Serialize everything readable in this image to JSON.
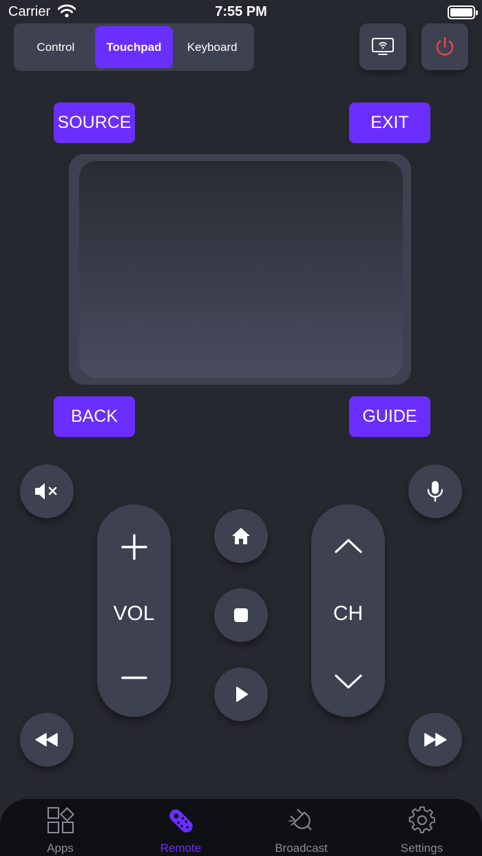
{
  "status_bar": {
    "carrier": "Carrier",
    "time": "7:55 PM"
  },
  "segments": [
    {
      "label": "Control",
      "active": false
    },
    {
      "label": "Touchpad",
      "active": true
    },
    {
      "label": "Keyboard",
      "active": false
    }
  ],
  "buttons": {
    "source": "SOURCE",
    "exit": "EXIT",
    "back": "BACK",
    "guide": "GUIDE"
  },
  "volume": {
    "label": "VOL"
  },
  "channel": {
    "label": "CH"
  },
  "tabs": [
    {
      "label": "Apps",
      "icon": "apps-icon",
      "active": false
    },
    {
      "label": "Remote",
      "icon": "remote-icon",
      "active": true
    },
    {
      "label": "Broadcast",
      "icon": "broadcast-icon",
      "active": false
    },
    {
      "label": "Settings",
      "icon": "gear-icon",
      "active": false
    }
  ],
  "colors": {
    "accent": "#6a2eff",
    "background": "#262830",
    "surface": "#3d4150",
    "power": "#e84545",
    "tab_bar": "#0f1014"
  }
}
